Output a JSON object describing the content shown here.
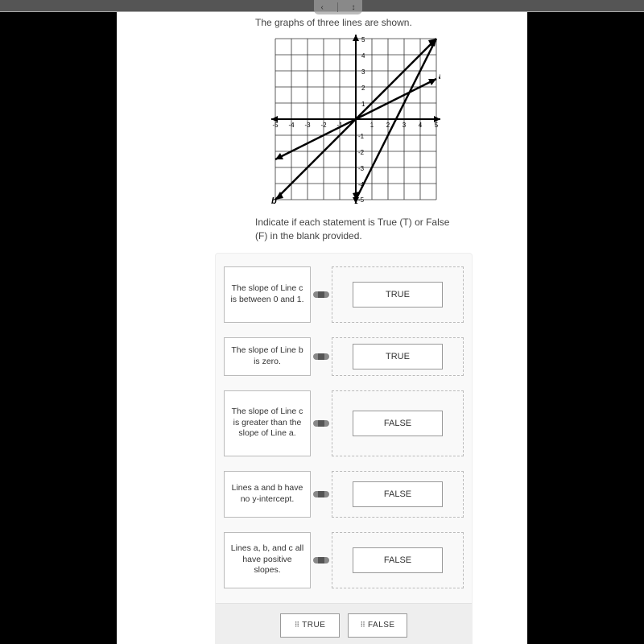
{
  "nav": {
    "left_icon": "‹",
    "right_icon": "↕"
  },
  "intro_text": "The graphs of three lines are shown.",
  "instruction_text": "Indicate if each statement is True (T) or False (F) in the blank provided.",
  "graph": {
    "x_ticks": [
      "-5",
      "-4",
      "-3",
      "-2",
      "-1",
      "1",
      "2",
      "3",
      "4",
      "5"
    ],
    "y_ticks": [
      "5",
      "4",
      "3",
      "2",
      "1",
      "-1",
      "-2",
      "-3",
      "-4",
      "-5"
    ],
    "line_labels": {
      "a": "a",
      "b": "b",
      "c": "c"
    }
  },
  "statements": [
    {
      "text": "The slope of Line c is between 0 and 1.",
      "answer": "TRUE",
      "short": false
    },
    {
      "text": "The slope of Line b is zero.",
      "answer": "TRUE",
      "short": true
    },
    {
      "text": "The slope of Line c is greater than the slope of Line a.",
      "answer": "FALSE",
      "short": false
    },
    {
      "text": "Lines a and b have no y-intercept.",
      "answer": "FALSE",
      "short": false
    },
    {
      "text": "Lines a, b, and c all have positive slopes.",
      "answer": "FALSE",
      "short": false
    }
  ],
  "chips": {
    "true_label": "TRUE",
    "false_label": "FALSE"
  },
  "chart_data": {
    "type": "line",
    "title": "",
    "xlabel": "",
    "ylabel": "",
    "xlim": [
      -5,
      5
    ],
    "ylim": [
      -5,
      5
    ],
    "x_ticks": [
      -5,
      -4,
      -3,
      -2,
      -1,
      0,
      1,
      2,
      3,
      4,
      5
    ],
    "y_ticks": [
      -5,
      -4,
      -3,
      -2,
      -1,
      0,
      1,
      2,
      3,
      4,
      5
    ],
    "grid": true,
    "series": [
      {
        "name": "a",
        "slope": 0.5,
        "intercept": 0,
        "points": [
          [
            -5,
            -2.5
          ],
          [
            5,
            2.5
          ]
        ]
      },
      {
        "name": "b",
        "slope": 1.0,
        "intercept": 0,
        "points": [
          [
            -5,
            -5
          ],
          [
            5,
            5
          ]
        ]
      },
      {
        "name": "c",
        "slope": 2.0,
        "intercept": -5,
        "points": [
          [
            0,
            -5
          ],
          [
            5,
            5
          ]
        ]
      }
    ]
  }
}
